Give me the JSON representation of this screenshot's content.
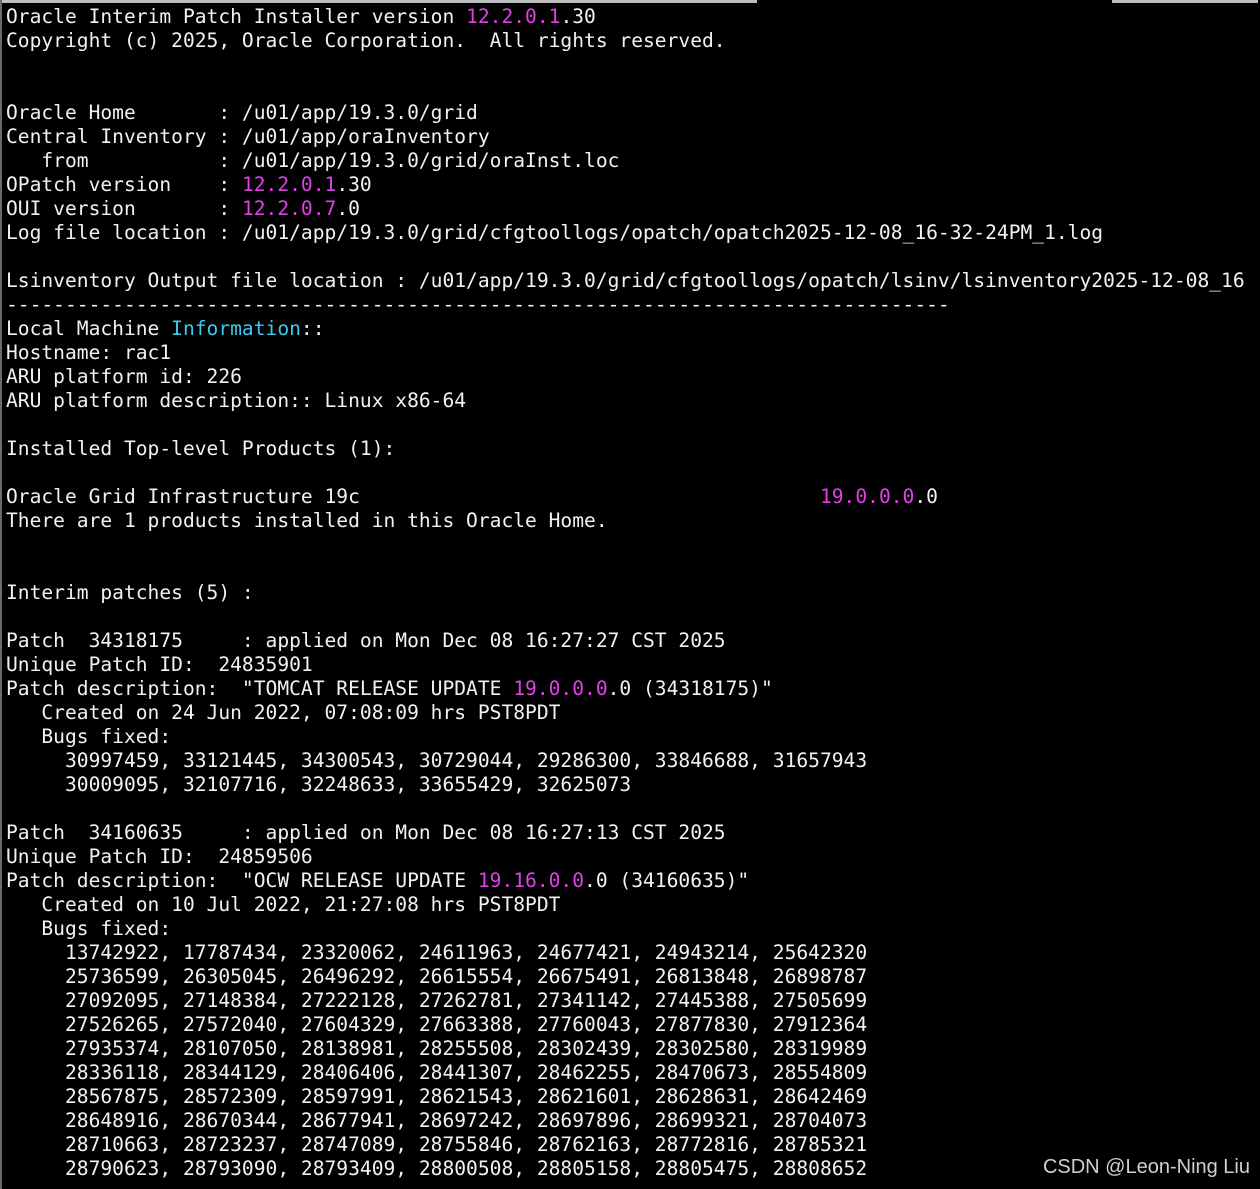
{
  "terminal": {
    "lines": [
      [
        {
          "t": "Oracle Interim Patch Installer version "
        },
        {
          "t": "12.2.0.1",
          "c": "magenta"
        },
        {
          "t": ".30"
        }
      ],
      [
        {
          "t": "Copyright (c) 2025, Oracle Corporation.  All rights reserved."
        }
      ],
      [
        {
          "t": ""
        }
      ],
      [
        {
          "t": ""
        }
      ],
      [
        {
          "t": "Oracle Home       : /u01/app/19.3.0/grid"
        }
      ],
      [
        {
          "t": "Central Inventory : /u01/app/oraInventory"
        }
      ],
      [
        {
          "t": "   from           : /u01/app/19.3.0/grid/oraInst.loc"
        }
      ],
      [
        {
          "t": "OPatch version    : "
        },
        {
          "t": "12.2.0.1",
          "c": "magenta"
        },
        {
          "t": ".30"
        }
      ],
      [
        {
          "t": "OUI version       : "
        },
        {
          "t": "12.2.0.7",
          "c": "magenta"
        },
        {
          "t": ".0"
        }
      ],
      [
        {
          "t": "Log file location : /u01/app/19.3.0/grid/cfgtoollogs/opatch/opatch2025-12-08_16-32-24PM_1.log"
        }
      ],
      [
        {
          "t": ""
        }
      ],
      [
        {
          "t": "Lsinventory Output file location : /u01/app/19.3.0/grid/cfgtoollogs/opatch/lsinv/lsinventory2025-12-08_16"
        }
      ],
      [
        {
          "t": "--------------------------------------------------------------------------------"
        }
      ],
      [
        {
          "t": "Local Machine "
        },
        {
          "t": "Information",
          "c": "cyan"
        },
        {
          "t": "::"
        }
      ],
      [
        {
          "t": "Hostname: rac1"
        }
      ],
      [
        {
          "t": "ARU platform id: 226"
        }
      ],
      [
        {
          "t": "ARU platform description:: Linux x86-64"
        }
      ],
      [
        {
          "t": ""
        }
      ],
      [
        {
          "t": "Installed Top-level Products (1):"
        }
      ],
      [
        {
          "t": ""
        }
      ],
      [
        {
          "t": "Oracle Grid Infrastructure 19c                                       "
        },
        {
          "t": "19.0.0.0",
          "c": "magenta"
        },
        {
          "t": ".0"
        }
      ],
      [
        {
          "t": "There are 1 products installed in this Oracle Home."
        }
      ],
      [
        {
          "t": ""
        }
      ],
      [
        {
          "t": ""
        }
      ],
      [
        {
          "t": "Interim patches (5) :"
        }
      ],
      [
        {
          "t": ""
        }
      ],
      [
        {
          "t": "Patch  34318175     : applied on Mon Dec 08 16:27:27 CST 2025"
        }
      ],
      [
        {
          "t": "Unique Patch ID:  24835901"
        }
      ],
      [
        {
          "t": "Patch description:  \"TOMCAT RELEASE UPDATE "
        },
        {
          "t": "19.0.0.0",
          "c": "magenta"
        },
        {
          "t": ".0 (34318175)\""
        }
      ],
      [
        {
          "t": "   Created on 24 Jun 2022, 07:08:09 hrs PST8PDT"
        }
      ],
      [
        {
          "t": "   Bugs fixed:"
        }
      ],
      [
        {
          "t": "     30997459, 33121445, 34300543, 30729044, 29286300, 33846688, 31657943"
        }
      ],
      [
        {
          "t": "     30009095, 32107716, 32248633, 33655429, 32625073"
        }
      ],
      [
        {
          "t": ""
        }
      ],
      [
        {
          "t": "Patch  34160635     : applied on Mon Dec 08 16:27:13 CST 2025"
        }
      ],
      [
        {
          "t": "Unique Patch ID:  24859506"
        }
      ],
      [
        {
          "t": "Patch description:  \"OCW RELEASE UPDATE "
        },
        {
          "t": "19.16.0.0",
          "c": "magenta"
        },
        {
          "t": ".0 (34160635)\""
        }
      ],
      [
        {
          "t": "   Created on 10 Jul 2022, 21:27:08 hrs PST8PDT"
        }
      ],
      [
        {
          "t": "   Bugs fixed:"
        }
      ],
      [
        {
          "t": "     13742922, 17787434, 23320062, 24611963, 24677421, 24943214, 25642320"
        }
      ],
      [
        {
          "t": "     25736599, 26305045, 26496292, 26615554, 26675491, 26813848, 26898787"
        }
      ],
      [
        {
          "t": "     27092095, 27148384, 27222128, 27262781, 27341142, 27445388, 27505699"
        }
      ],
      [
        {
          "t": "     27526265, 27572040, 27604329, 27663388, 27760043, 27877830, 27912364"
        }
      ],
      [
        {
          "t": "     27935374, 28107050, 28138981, 28255508, 28302439, 28302580, 28319989"
        }
      ],
      [
        {
          "t": "     28336118, 28344129, 28406406, 28441307, 28462255, 28470673, 28554809"
        }
      ],
      [
        {
          "t": "     28567875, 28572309, 28597991, 28621543, 28621601, 28628631, 28642469"
        }
      ],
      [
        {
          "t": "     28648916, 28670344, 28677941, 28697242, 28697896, 28699321, 28704073"
        }
      ],
      [
        {
          "t": "     28710663, 28723237, 28747089, 28755846, 28762163, 28772816, 28785321"
        }
      ],
      [
        {
          "t": "     28790623, 28793090, 28793409, 28800508, 28805158, 28805475, 28808652"
        }
      ]
    ]
  },
  "watermark": "CSDN @Leon-Ning Liu",
  "colors": {
    "background": "#000000",
    "foreground": "#f2f2f2",
    "version_highlight": "#e040e8",
    "keyword_highlight": "#3ec8f0"
  }
}
